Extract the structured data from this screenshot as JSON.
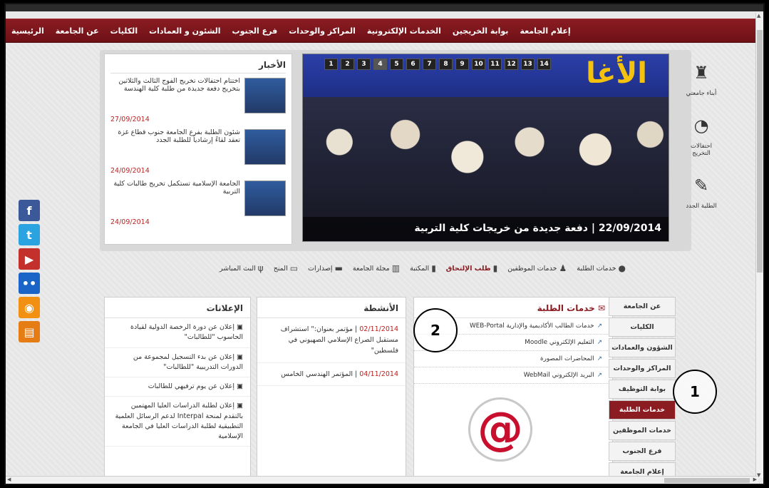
{
  "nav": {
    "items": [
      "الرئيسية",
      "عن الجامعة",
      "الكليات",
      "الشئون و العمادات",
      "فرع الجنوب",
      "المراكز والوحدات",
      "الخدمات الإلكترونية",
      "بوابة الخريجين",
      "إعلام الجامعة"
    ]
  },
  "news": {
    "title": "الأخبار",
    "items": [
      {
        "text": "اختتام احتفالات تخريج الفوج الثالث والثلاثين بتخريج دفعة جديدة من طلبة كلية الهندسة",
        "date": "27/09/2014"
      },
      {
        "text": "شئون الطلبة بفرع الجامعة جنوب قطاع غزة تعقد لقاءً إرشادياً للطلبة الجدد",
        "date": "24/09/2014"
      },
      {
        "text": "الجامعة الإسلامية تستكمل تخريج طالبات كلية التربية",
        "date": "24/09/2014"
      }
    ]
  },
  "slider": {
    "numbers": [
      "1",
      "2",
      "3",
      "4",
      "5",
      "6",
      "7",
      "8",
      "9",
      "10",
      "11",
      "12",
      "13",
      "14"
    ],
    "active": "4",
    "banner_text": "الأغا",
    "caption": "22/09/2014 | دفعة جديدة من خريجات كلية التربية"
  },
  "side_icons": [
    {
      "icon": "graduate-icon",
      "label": "أبناء جامعتي"
    },
    {
      "icon": "graduation-cap-icon",
      "label": "احتفالات التخريج"
    },
    {
      "icon": "new-students-icon",
      "label": "الطلبة الجدد"
    }
  ],
  "quick_links": [
    {
      "label": "خدمات الطلبة",
      "icon": "student-icon"
    },
    {
      "label": "خدمات الموظفين",
      "icon": "employee-icon"
    },
    {
      "label": "طلب الإلتحاق",
      "icon": "document-icon",
      "highlight": true
    },
    {
      "label": "المكتبة",
      "icon": "document-icon"
    },
    {
      "label": "مجلة الجامعة",
      "icon": "book-icon"
    },
    {
      "label": "إصدارات",
      "icon": "folder-icon"
    },
    {
      "label": "المنح",
      "icon": "envelope-icon"
    },
    {
      "label": "البث المباشر",
      "icon": "plant-icon"
    }
  ],
  "announcements": {
    "title": "الإعلانات",
    "items": [
      "إعلان عن دورة الرخصة الدولية لقيادة الحاسوب \"للطالبات\"",
      "إعلان عن بدء التسجيل لمجموعة من الدورات التدريبية \"للطالبات\"",
      "إعلان عن يوم ترفيهي للطالبات",
      "إعلان لطلبة الدراسات العليا المهتمين بالتقدم لمنحة Interpal لدعم الرسائل العلمية التطبيقية لطلبة الدراسات العليا في الجامعة الإسلامية"
    ]
  },
  "activities": {
    "title": "الأنشطة",
    "items": [
      {
        "date": "02/11/2014",
        "text": "مؤتمر بعنوان:\" استشراف مستقبل الصراع الإسلامي الصهيوني في فلسطين\""
      },
      {
        "date": "04/11/2014",
        "text": "المؤتمر الهندسي الخامس"
      }
    ]
  },
  "services": {
    "title": "خدمات الطلبة",
    "items": [
      "خدمات الطالب الأكاديمية والإدارية WEB-Portal",
      "التعليم الإلكتروني Moodle",
      "المحاضرات المصورة",
      "البريد الإلكتروني WebMail"
    ],
    "logo": "@"
  },
  "side_menu": {
    "items": [
      "عن الجامعة",
      "الكليات",
      "الشؤون والعمادات",
      "المراكز والوحدات",
      "بوابة التوظيف",
      "خدمات الطلبة",
      "خدمات الموظفين",
      "فرع الجنوب",
      "إعلام الجامعة"
    ],
    "active": "خدمات الطلبة"
  },
  "callouts": [
    "1",
    "2"
  ],
  "social": [
    {
      "icon": "facebook-icon",
      "glyph": "f",
      "color": "#3b5998"
    },
    {
      "icon": "twitter-icon",
      "glyph": "t",
      "color": "#2aa3e0"
    },
    {
      "icon": "youtube-icon",
      "glyph": "▶",
      "color": "#c4302b"
    },
    {
      "icon": "flickr-icon",
      "glyph": "••",
      "color": "#1a63c7"
    },
    {
      "icon": "rss-icon",
      "glyph": "◉",
      "color": "#f29111"
    },
    {
      "icon": "folder-icon",
      "glyph": "▤",
      "color": "#e57d14"
    }
  ],
  "colors": {
    "brand": "#8a1c22",
    "date": "#bb2222"
  }
}
